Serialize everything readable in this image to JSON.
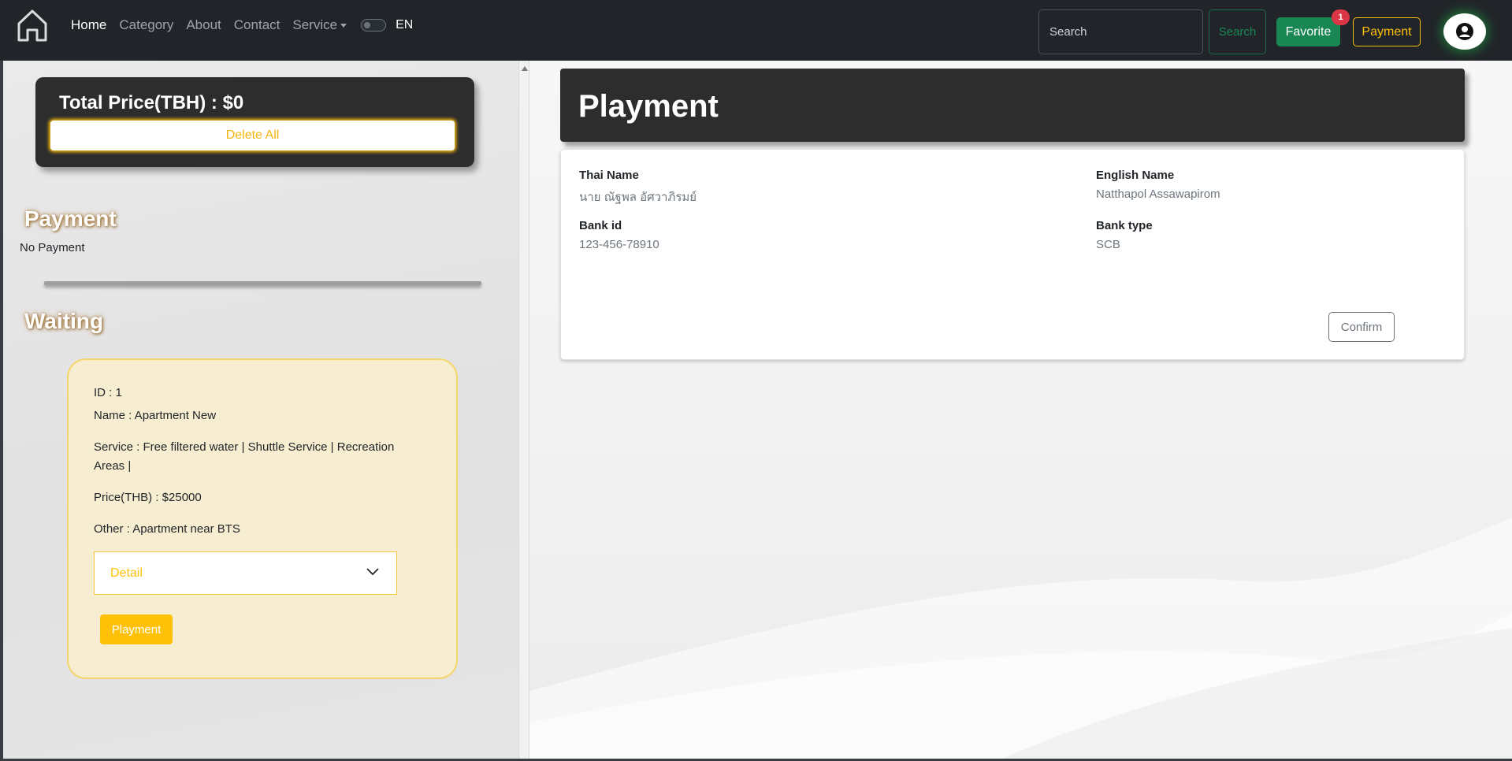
{
  "navbar": {
    "links": [
      "Home",
      "Category",
      "About",
      "Contact"
    ],
    "service_label": "Service",
    "lang": "EN",
    "search_placeholder": "Search",
    "search_button": "Search",
    "favorite_label": "Favorite",
    "favorite_count": "1",
    "payment_label": "Payment"
  },
  "left": {
    "total_title": "Total Price(TBH) : $0",
    "delete_all": "Delete All",
    "payment_heading": "Payment",
    "no_payment": "No Payment",
    "waiting_heading": "Waiting",
    "item": {
      "id": "ID : 1",
      "name": "Name : Apartment New",
      "service": "Service : Free filtered water | Shuttle Service | Recreation Areas |",
      "price": "Price(THB) : $25000",
      "other": "Other : Apartment near BTS",
      "detail": "Detail",
      "pay_button": "Playment"
    }
  },
  "right": {
    "header_title": "Playment",
    "thai_name_label": "Thai Name",
    "thai_name_value": "นาย ณัฐพล อัศวาภิรมย์",
    "english_name_label": "English Name",
    "english_name_value": "Natthapol Assawapirom",
    "bank_id_label": "Bank id",
    "bank_id_value": "123-456-78910",
    "bank_type_label": "Bank type",
    "bank_type_value": "SCB",
    "confirm": "Confirm"
  },
  "colors": {
    "navbar_bg": "#212529",
    "success": "#198754",
    "warning": "#ffc107",
    "danger": "#dc3545",
    "card_dark": "#2d2d2d"
  }
}
